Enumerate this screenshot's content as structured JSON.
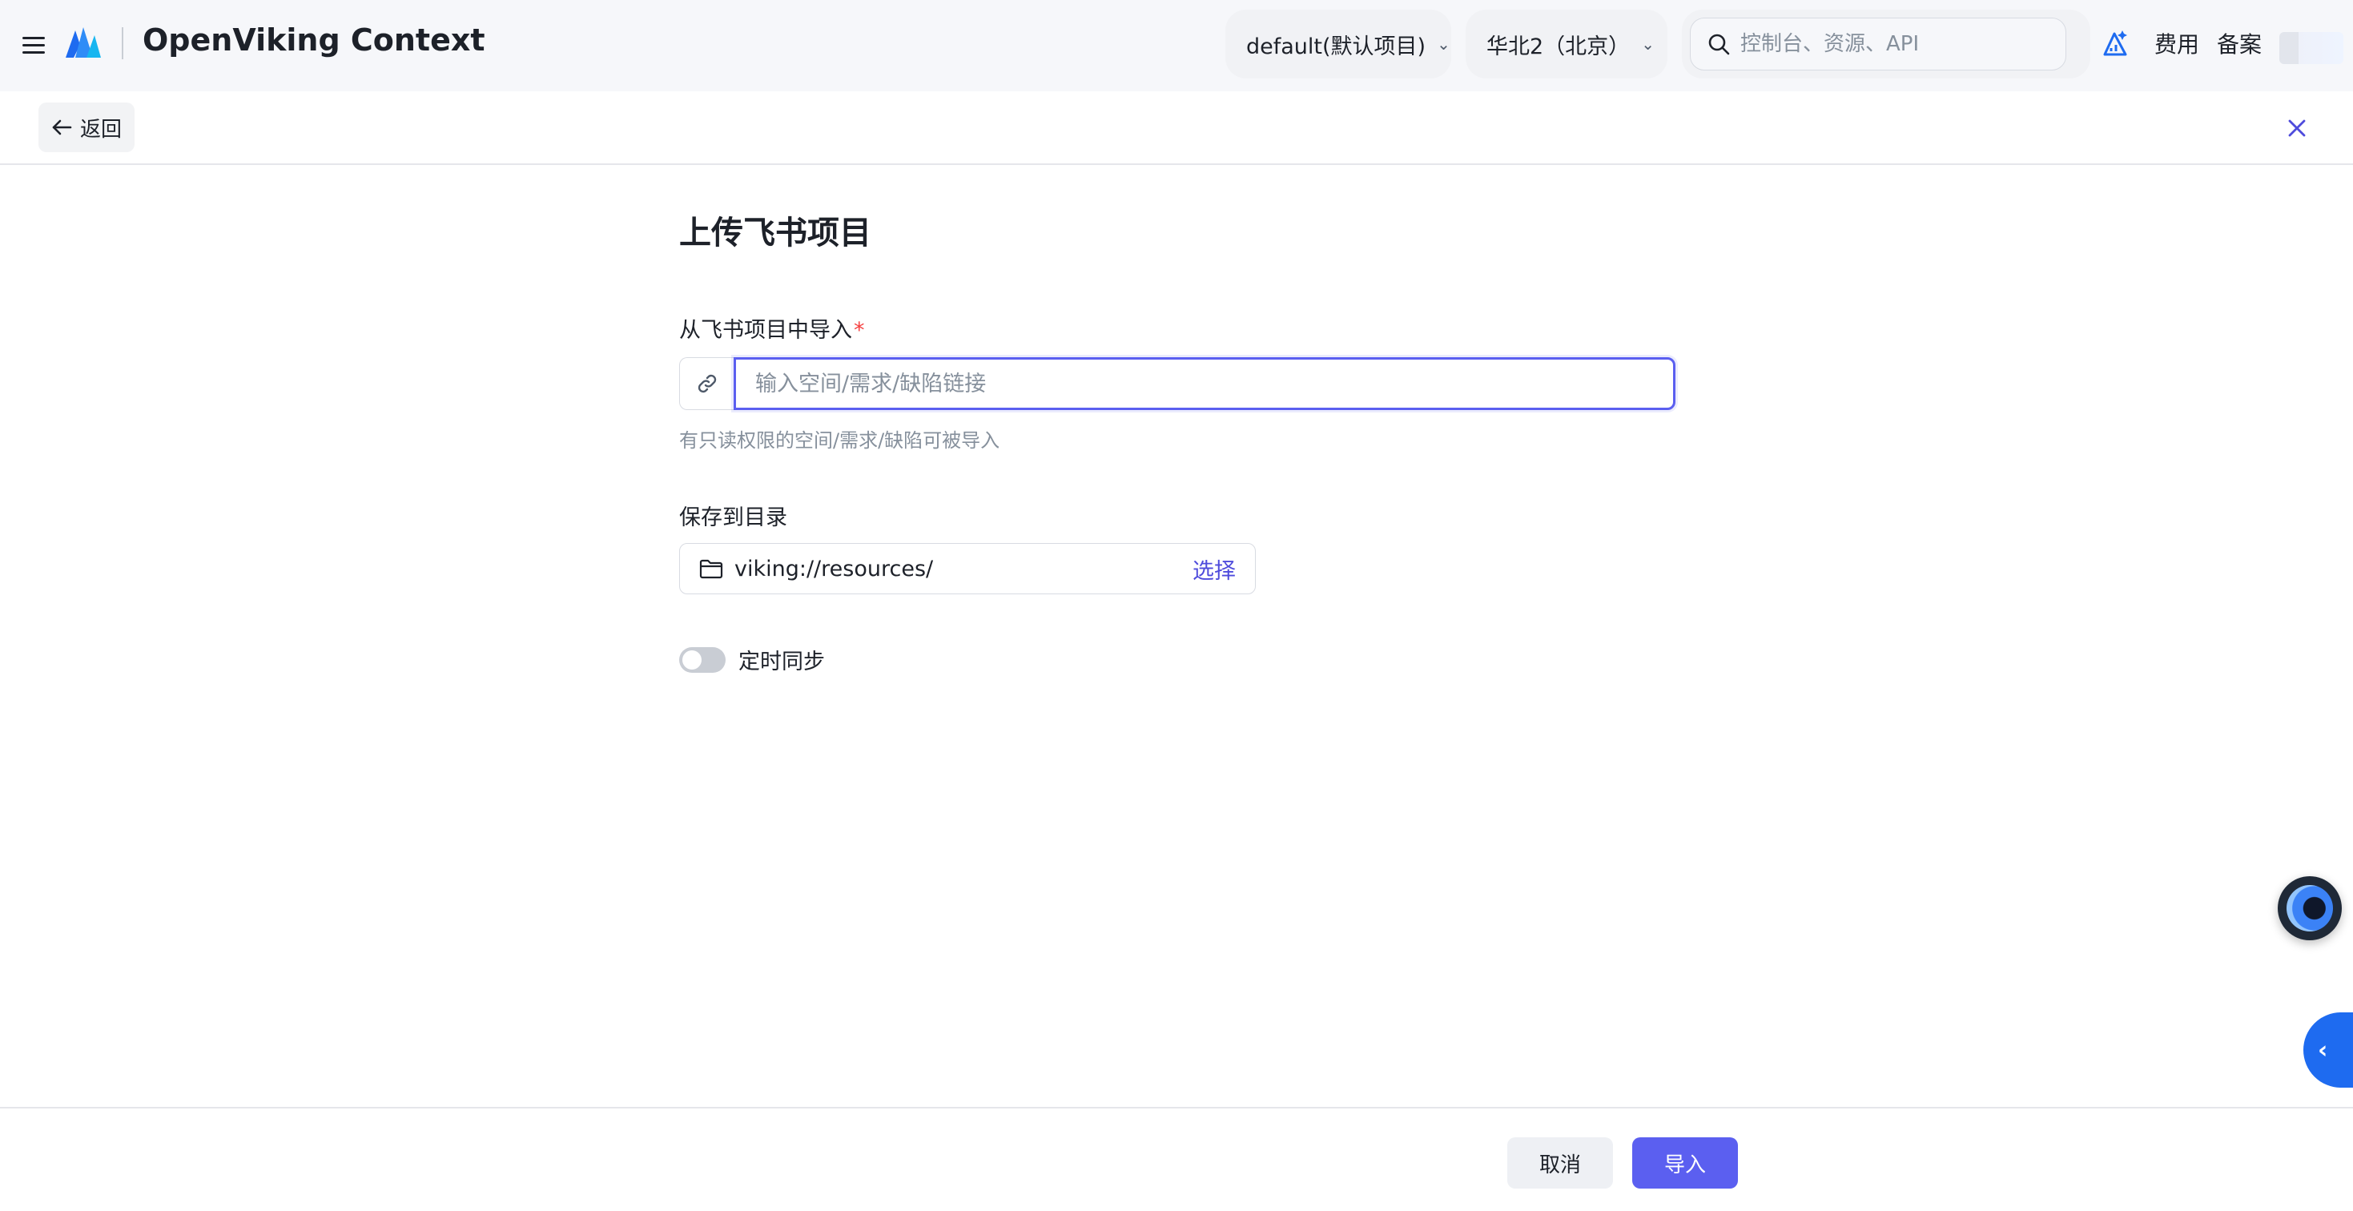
{
  "header": {
    "title": "OpenViking Context",
    "project": "default(默认项目)",
    "region": "华北2（北京）",
    "search_placeholder": "控制台、资源、API",
    "fee_link": "费用",
    "beian_link": "备案"
  },
  "subbar": {
    "back_label": "返回"
  },
  "form": {
    "title": "上传飞书项目",
    "import_label": "从飞书项目中导入",
    "required_mark": "*",
    "link_placeholder": "输入空间/需求/缺陷链接",
    "link_value": "",
    "hint": "有只读权限的空间/需求/缺陷可被导入",
    "dir_label": "保存到目录",
    "dir_value": "viking://resources/",
    "dir_select": "选择",
    "sync_label": "定时同步",
    "sync_enabled": false
  },
  "footer": {
    "cancel_label": "取消",
    "import_label": "导入"
  },
  "colors": {
    "primary": "#5b5ff0",
    "required": "#f53f3f",
    "side_tab": "#1e6bf0"
  }
}
